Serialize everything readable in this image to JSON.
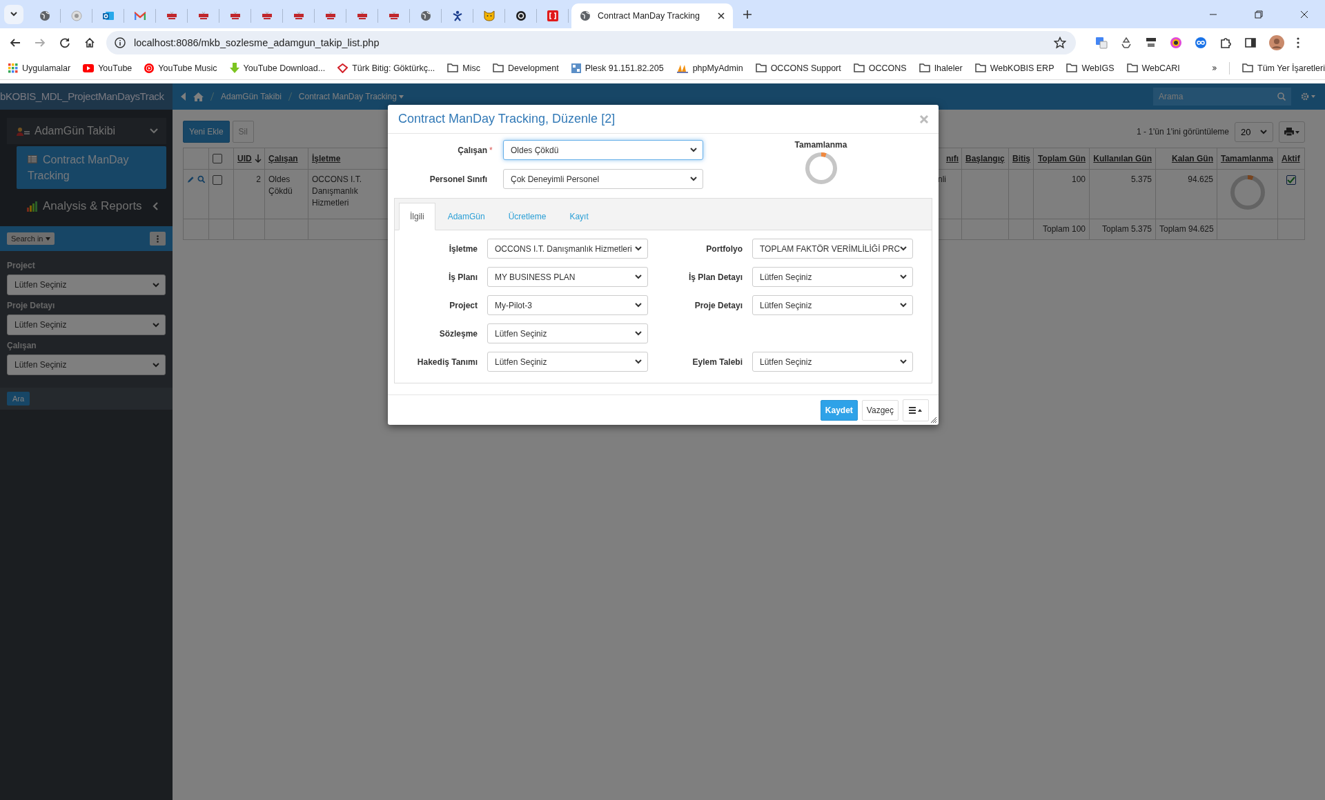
{
  "browser": {
    "tabs": [
      {
        "kind": "globe",
        "selected": false
      },
      {
        "kind": "dot",
        "selected": false
      },
      {
        "kind": "outlook",
        "selected": false
      },
      {
        "kind": "gmail",
        "selected": false
      },
      {
        "kind": "occons",
        "selected": false
      },
      {
        "kind": "occons",
        "selected": false
      },
      {
        "kind": "occons",
        "selected": false
      },
      {
        "kind": "occons",
        "selected": false
      },
      {
        "kind": "occons",
        "selected": false
      },
      {
        "kind": "occons",
        "selected": false
      },
      {
        "kind": "occons",
        "selected": false
      },
      {
        "kind": "occons",
        "selected": false
      },
      {
        "kind": "globe",
        "selected": false
      },
      {
        "kind": "figure",
        "selected": false
      },
      {
        "kind": "cat",
        "selected": false
      },
      {
        "kind": "ring",
        "selected": false
      },
      {
        "kind": "bracket",
        "selected": false
      },
      {
        "kind": "globe",
        "title": "Contract ManDay Tracking",
        "selected": true
      }
    ],
    "address": "localhost:8086/mkb_sozlesme_adamgun_takip_list.php",
    "bookmarks": [
      {
        "kind": "apps",
        "label": "Uygulamalar"
      },
      {
        "kind": "youtube",
        "label": "YouTube"
      },
      {
        "kind": "music",
        "label": "YouTube Music"
      },
      {
        "kind": "download",
        "label": "YouTube Download..."
      },
      {
        "kind": "bitig",
        "label": "Türk Bitig: Göktürkç..."
      },
      {
        "kind": "folder",
        "label": "Misc"
      },
      {
        "kind": "folder",
        "label": "Development"
      },
      {
        "kind": "plesk",
        "label": "Plesk 91.151.82.205"
      },
      {
        "kind": "pma",
        "label": "phpMyAdmin"
      },
      {
        "kind": "folder",
        "label": "OCCONS Support"
      },
      {
        "kind": "folder",
        "label": "OCCONS"
      },
      {
        "kind": "folder",
        "label": "Ihaleler"
      },
      {
        "kind": "folder",
        "label": "WebKOBIS ERP"
      },
      {
        "kind": "folder",
        "label": "WebIGS"
      },
      {
        "kind": "folder",
        "label": "WebCARI"
      }
    ],
    "all_bookmarks": "Tüm Yer İşaretleri"
  },
  "app": {
    "brand": "bKOBIS_MDL_ProjectManDaysTrack",
    "breadcrumbs": [
      "AdamGün Takibi",
      "Contract ManDay Tracking"
    ],
    "search_placeholder": "Arama",
    "sidebar": {
      "items": [
        {
          "label": "AdamGün Takibi",
          "expanded": true,
          "selected": false,
          "children": [
            {
              "label": "Contract ManDay Tracking",
              "selected": true
            }
          ]
        },
        {
          "label": "Analysis & Reports",
          "expanded": false,
          "selected": false
        }
      ]
    },
    "search_panel": {
      "button": "Search in",
      "filters": [
        {
          "label": "Project",
          "value": "Lütfen Seçiniz"
        },
        {
          "label": "Proje Detayı",
          "value": "Lütfen Seçiniz"
        },
        {
          "label": "Çalışan",
          "value": "Lütfen Seçiniz"
        }
      ],
      "submit": "Ara"
    },
    "toolbar": {
      "buttons": [
        {
          "label": "Yeni Ekle",
          "kind": "primary"
        },
        {
          "label": "Sil",
          "kind": "default"
        }
      ],
      "record_info": "1 - 1'ün 1'ini görüntüleme",
      "page_size": "20"
    },
    "table": {
      "select_all_checked": false,
      "columns": [
        {
          "label": "UID",
          "sorted": true
        },
        {
          "label": "Çalışan",
          "sorted": false
        },
        {
          "label": "İşletme",
          "sorted": false
        },
        {
          "label": "nıfı",
          "sorted": false
        },
        {
          "label": "Başlangıç",
          "sorted": false
        },
        {
          "label": "Bitiş",
          "sorted": false
        },
        {
          "label": "Toplam Gün",
          "sorted": false
        },
        {
          "label": "Kullanılan Gün",
          "sorted": false
        },
        {
          "label": "Kalan Gün",
          "sorted": false
        },
        {
          "label": "Tamamlanma",
          "sorted": false
        },
        {
          "label": "Aktif",
          "sorted": false
        }
      ],
      "rows": [
        {
          "checked": false,
          "uid": "2",
          "calisan": "Oldes Çökdü",
          "isletme": "OCCONS I.T. Danışmanlık Hizmetleri",
          "cut_column": "nli",
          "toplam_gun": "100",
          "kullanilan_gun": "5.375",
          "kalan_gun": "94.625",
          "level": 0.054,
          "aktif": true
        }
      ],
      "totals": {
        "toplam_gun": "Toplam 100",
        "kullanilan_gun": "Toplam 5.375",
        "kalan_gun": "Toplam 94.625"
      }
    }
  },
  "modal": {
    "title": "Contract ManDay Tracking, Düzenle [2]",
    "top_fields": [
      {
        "label": "Çalışan",
        "mark": "*",
        "value": "Oldes Çökdü",
        "focused": true
      },
      {
        "label": "Personel Sınıfı",
        "value": "Çok Deneyimli Personel",
        "focused": false
      }
    ],
    "completion": {
      "label": "Tamamlanma",
      "level": 0.054
    },
    "tabs": [
      {
        "label": "İlgili",
        "selected": true
      },
      {
        "label": "AdamGün",
        "selected": false
      },
      {
        "label": "Ücretleme",
        "selected": false
      },
      {
        "label": "Kayıt",
        "selected": false
      }
    ],
    "form_rows": [
      {
        "left": {
          "label": "İşletme",
          "value": "OCCONS I.T. Danışmanlık Hizmetleri"
        },
        "right": {
          "label": "Portfolyo",
          "value": "TOPLAM FAKTÖR VERİMLİLİĞİ PRC"
        }
      },
      {
        "left": {
          "label": "İş Planı",
          "value": "MY BUSINESS PLAN"
        },
        "right": {
          "label": "İş Plan Detayı",
          "value": "Lütfen Seçiniz"
        }
      },
      {
        "left": {
          "label": "Project",
          "value": "My-Pilot-3"
        },
        "right": {
          "label": "Proje Detayı",
          "value": "Lütfen Seçiniz"
        }
      },
      {
        "left": {
          "label": "Sözleşme",
          "value": "Lütfen Seçiniz"
        }
      },
      {
        "left": {
          "label": "Hakediş Tanımı",
          "value": "Lütfen Seçiniz"
        },
        "right": {
          "label": "Eylem Talebi",
          "value": "Lütfen Seçiniz"
        }
      }
    ],
    "buttons": [
      {
        "label": "Kaydet",
        "kind": "primary"
      },
      {
        "label": "Vazgeç",
        "kind": "default"
      }
    ]
  }
}
